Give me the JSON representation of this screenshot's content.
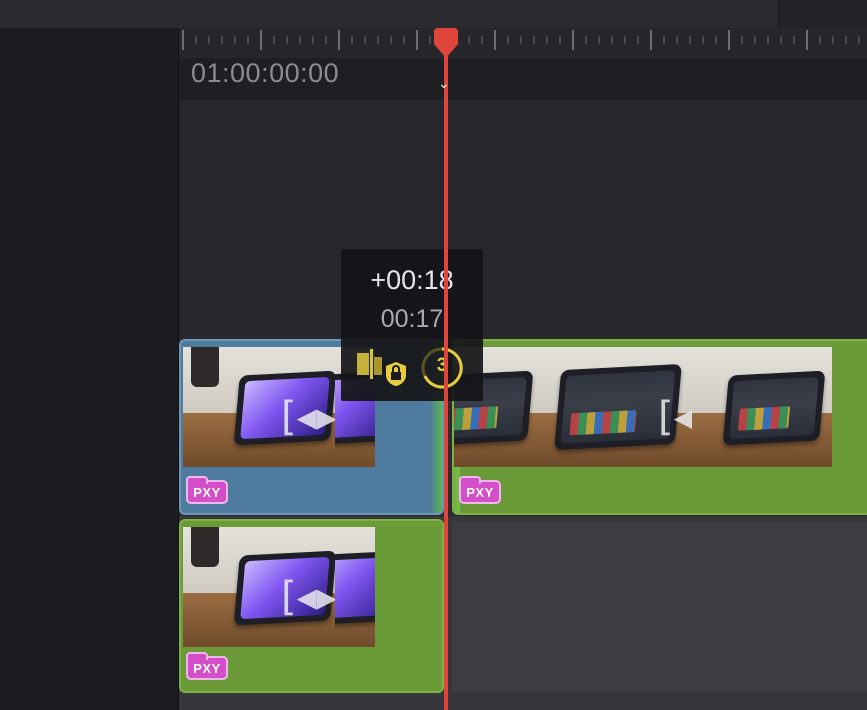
{
  "timeline": {
    "start_timecode": "01:00:00:00",
    "accent_color": "#e0453b",
    "clip_colors": {
      "blue": "#4e7b9e",
      "green": "#6b9a39"
    }
  },
  "trim_tooltip": {
    "offset": "+00:18",
    "duration": "00:17",
    "counter": "3"
  },
  "clips": [
    {
      "badge": "PXY",
      "track": "video",
      "color": "blue"
    },
    {
      "badge": "PXY",
      "track": "video",
      "color": "green"
    },
    {
      "badge": "PXY",
      "track": "video-lower",
      "color": "green"
    }
  ],
  "icons": {
    "playhead": "playhead-marker-icon",
    "trim": "trim-edit-icon",
    "lock": "lock-icon",
    "transition_bracket": "transition-bracket-icon"
  }
}
